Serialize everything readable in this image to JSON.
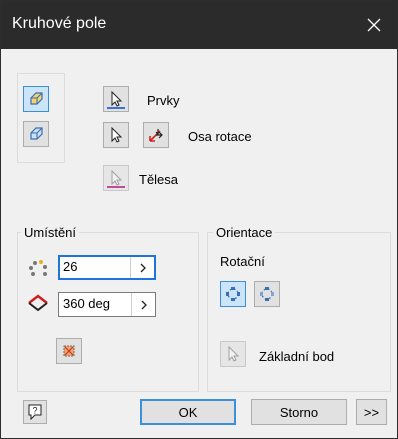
{
  "window": {
    "title": "Kruhové pole"
  },
  "icons": {
    "close": "close-icon",
    "solid_mode": "solid-feature-icon",
    "surface_mode": "surface-feature-icon",
    "select_cursor": "cursor-arrow-icon",
    "flip_axis": "flip-direction-icon",
    "count": "pattern-count-icon",
    "angle": "angle-icon",
    "fit_midplane": "midplane-icon",
    "rotational": "rotational-orientation-icon",
    "fixed": "fixed-orientation-icon",
    "help": "help-icon"
  },
  "selection": {
    "features_label": "Prvky",
    "axis_label": "Osa rotace",
    "bodies_label": "Tělesa"
  },
  "placement": {
    "title": "Umístění",
    "count_value": "26",
    "angle_value": "360 deg"
  },
  "orientation": {
    "title": "Orientace",
    "rotational_label": "Rotační",
    "base_point_label": "Základní bod"
  },
  "footer": {
    "ok_label": "OK",
    "cancel_label": "Storno",
    "more_label": ">>"
  },
  "colors": {
    "active_border": "#3b8fd9",
    "active_fill": "#cce4f7",
    "underline_blue": "#3c70d6",
    "underline_magenta": "#c04c9a",
    "titlebar": "#2b2b2b"
  }
}
